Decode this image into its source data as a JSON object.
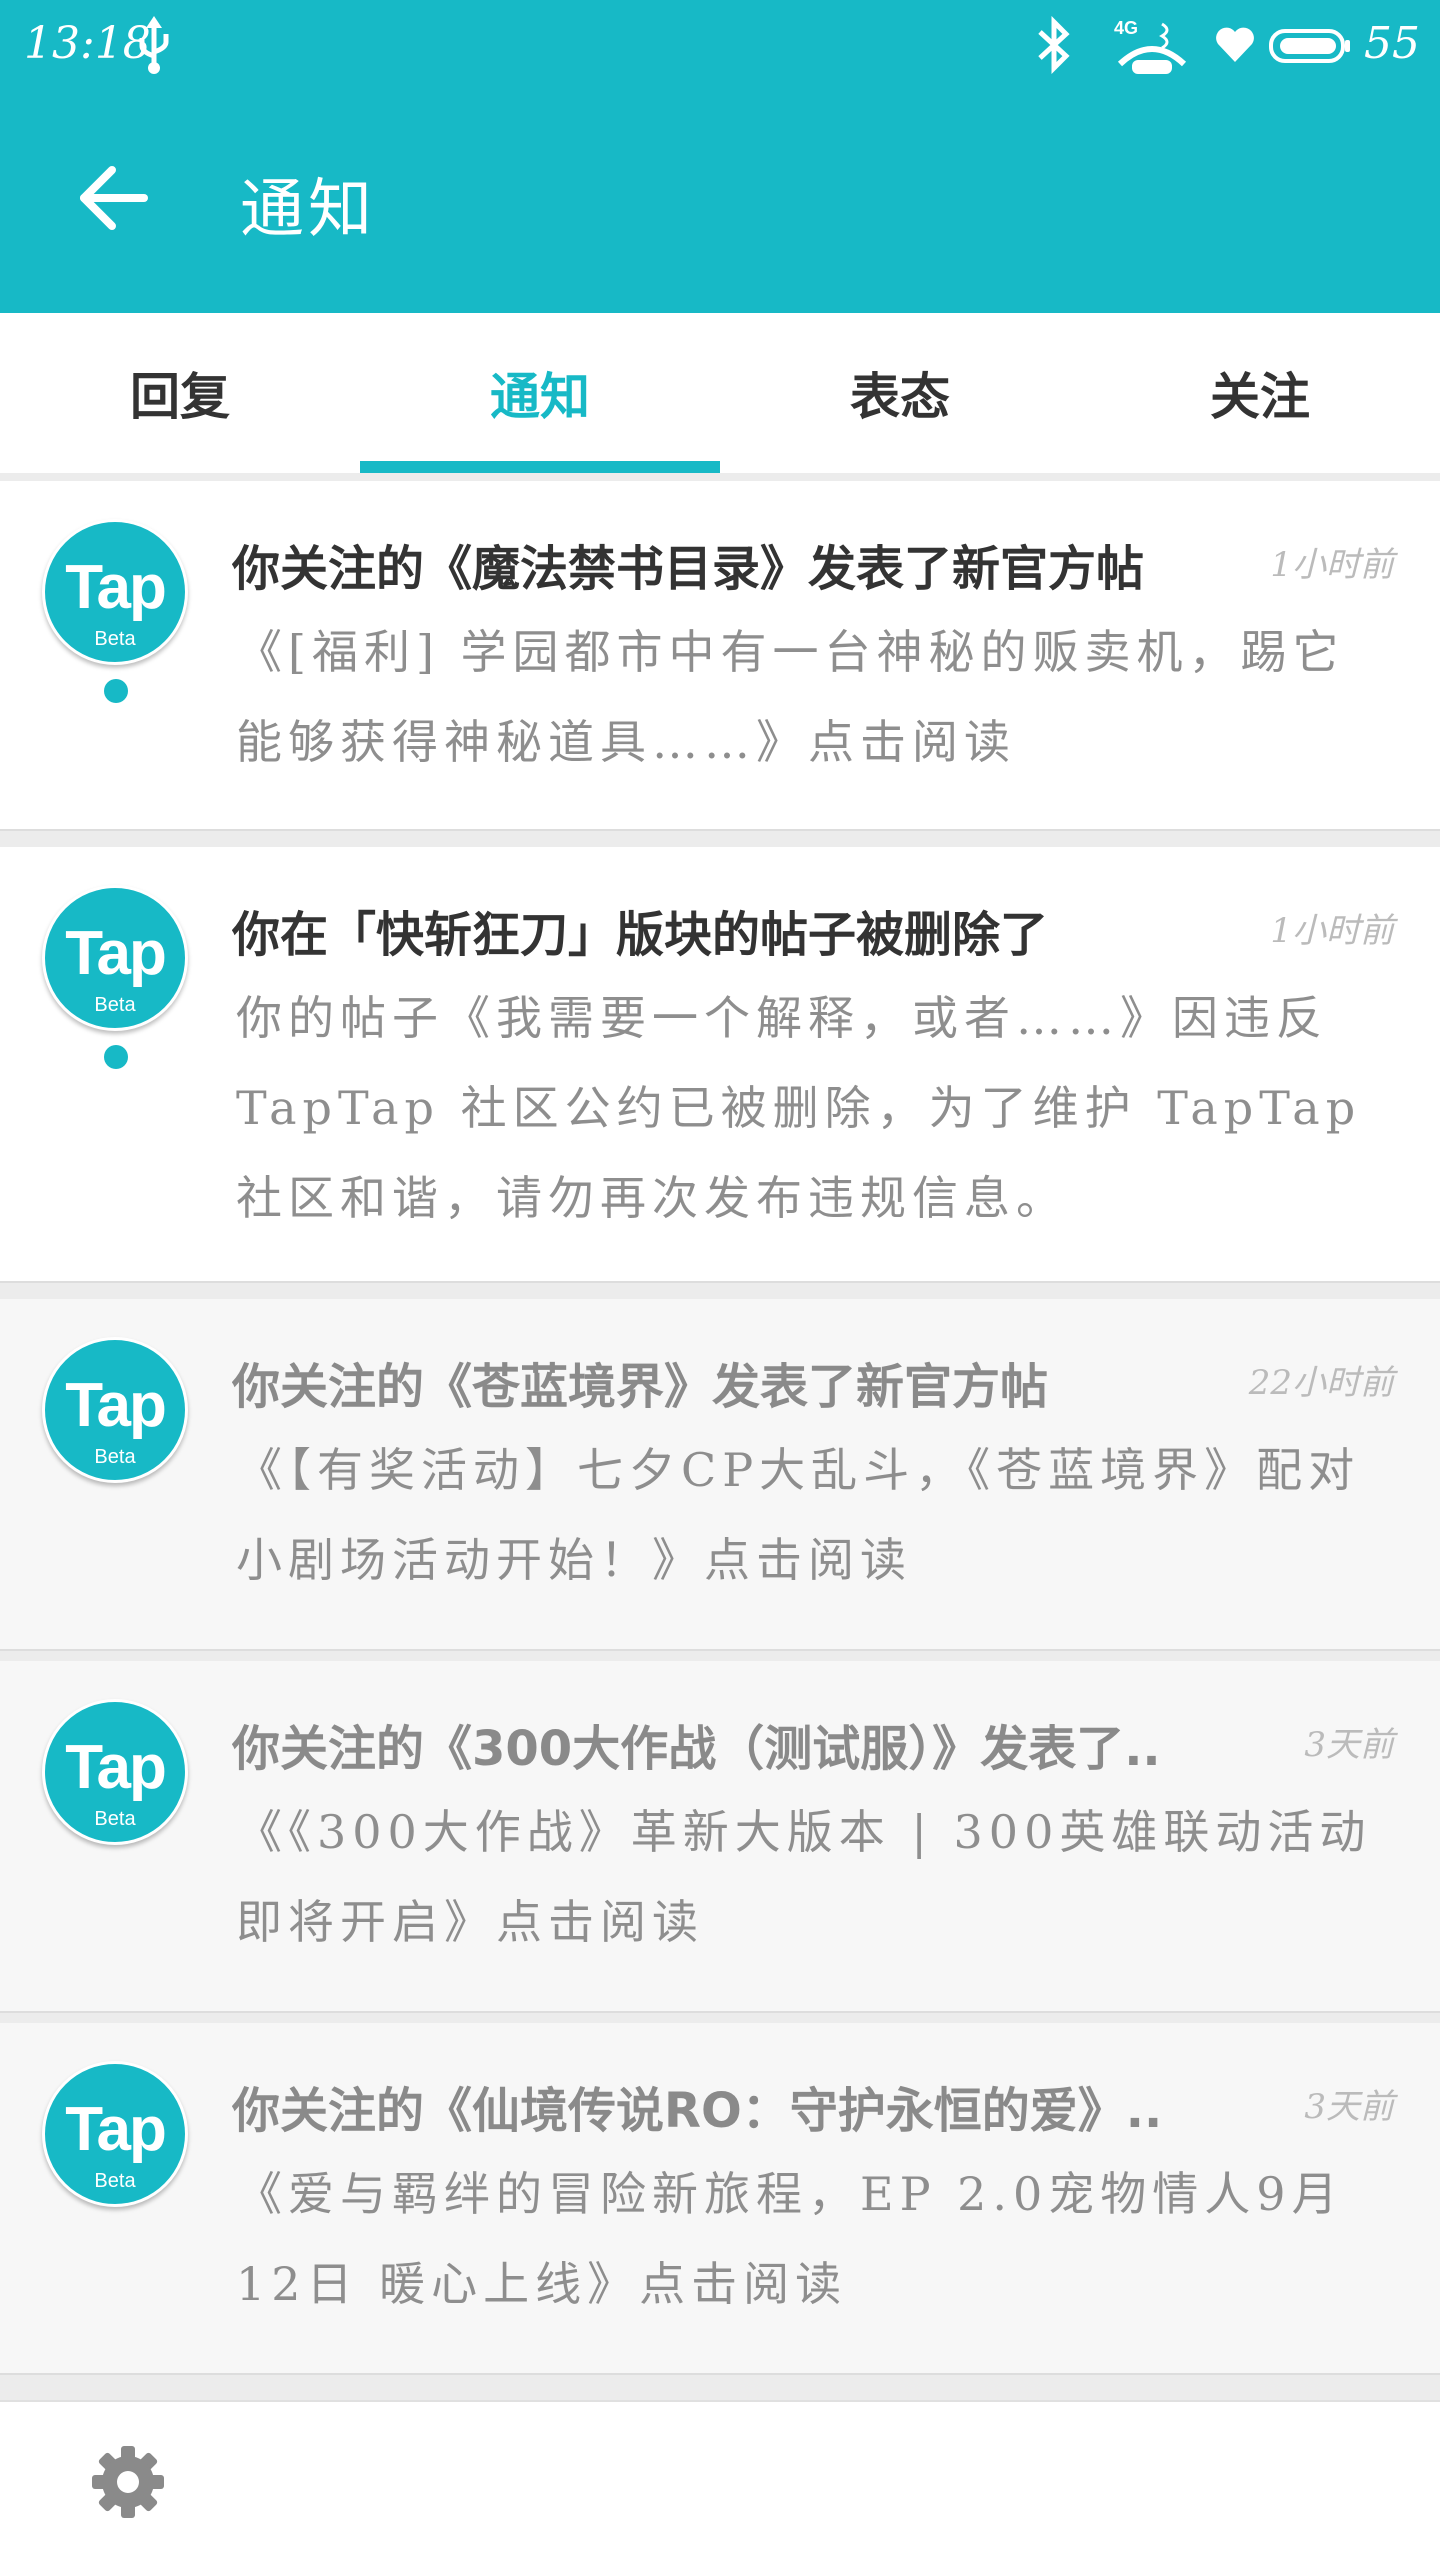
{
  "status_bar": {
    "time": "13:18",
    "network": "4G",
    "battery": "55",
    "icons": [
      "usb-icon",
      "bluetooth-icon",
      "signal-icon",
      "heart-icon",
      "battery-icon"
    ]
  },
  "header": {
    "title": "通知",
    "back_icon": "arrow-left-icon"
  },
  "tabs": [
    {
      "label": "回复",
      "active": false
    },
    {
      "label": "通知",
      "active": true
    },
    {
      "label": "表态",
      "active": false
    },
    {
      "label": "关注",
      "active": false
    }
  ],
  "avatar": {
    "logo": "Tap",
    "sub": "Beta"
  },
  "notifications": [
    {
      "title": "你关注的《魔法禁书目录》发表了新官方帖",
      "time": "1小时前",
      "body": "《[福利] 学园都市中有一台神秘的贩卖机，踢它能够获得神秘道具……》点击阅读",
      "unread": true
    },
    {
      "title": "你在「快斩狂刀」版块的帖子被删除了",
      "time": "1小时前",
      "body": "你的帖子《我需要一个解释，或者……》因违反 TapTap 社区公约已被删除，为了维护 TapTap 社区和谐，请勿再次发布违规信息。",
      "unread": true
    },
    {
      "title": "你关注的《苍蓝境界》发表了新官方帖",
      "time": "22小时前",
      "body": "《【有奖活动】七夕CP大乱斗，《苍蓝境界》配对小剧场活动开始！》点击阅读",
      "unread": false
    },
    {
      "title": "你关注的《300大作战（测试服）》发表了..",
      "time": "3天前",
      "body": "《《300大作战》革新大版本 | 300英雄联动活动即将开启》点击阅读",
      "unread": false
    },
    {
      "title": "你关注的《仙境传说RO：守护永恒的爱》..",
      "time": "3天前",
      "body": "《爱与羁绊的冒险新旅程，EP 2.0宠物情人9月12日 暖心上线》点击阅读",
      "unread": false
    }
  ],
  "bottom_bar": {
    "settings_icon": "gear-icon"
  },
  "colors": {
    "accent": "#17b9c6",
    "title_unread": "#333333",
    "title_read": "#8a8a8a",
    "body_text": "#8e8e8e",
    "time_text": "#bbbbbb"
  }
}
